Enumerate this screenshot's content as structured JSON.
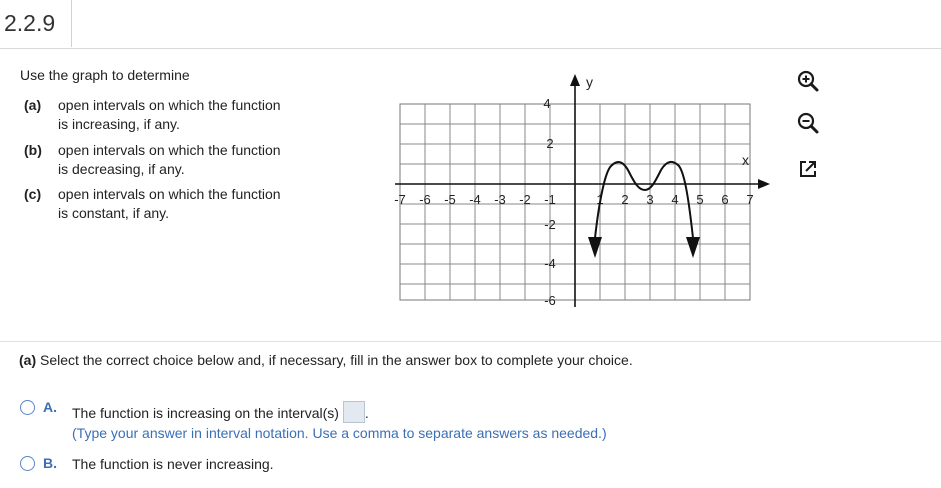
{
  "header": {
    "problem_number": "2.2.9"
  },
  "question": {
    "intro": "Use the graph to determine",
    "items": [
      {
        "label": "(a)",
        "text": "open intervals on which the function is increasing, if any."
      },
      {
        "label": "(b)",
        "text": "open intervals on which the function is decreasing, if any."
      },
      {
        "label": "(c)",
        "text": "open intervals on which the function is constant, if any."
      }
    ]
  },
  "graph": {
    "x_axis_label": "x",
    "y_axis_label": "y",
    "x_ticks": [
      "-7",
      "-6",
      "-5",
      "-4",
      "-3",
      "-2",
      "-1",
      "1",
      "2",
      "3",
      "4",
      "5",
      "6",
      "7"
    ],
    "y_ticks": [
      "4",
      "2",
      "-2",
      "-4",
      "-6"
    ]
  },
  "tools": [
    "zoom-in-icon",
    "zoom-out-icon",
    "popout-icon"
  ],
  "part_a": {
    "label": "(a)",
    "instruction": "Select the correct choice below and, if necessary, fill in the answer box to complete your choice.",
    "options": [
      {
        "letter": "A.",
        "text": "The function is increasing on the interval(s)",
        "trailing": ".",
        "hint": "(Type your answer in interval notation. Use a comma to separate answers as needed.)"
      },
      {
        "letter": "B.",
        "text": "The function is never increasing."
      }
    ]
  }
}
